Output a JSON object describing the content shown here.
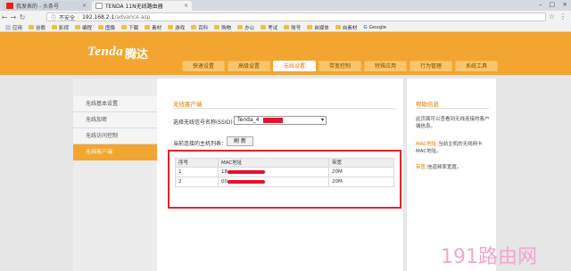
{
  "browser": {
    "tabs": [
      {
        "title": "我发表的 - 头条号"
      },
      {
        "title": "TENDA 11N无线路由器"
      }
    ],
    "address": {
      "security": "不安全",
      "host": "192.168.2.1",
      "path": "/advance.asp"
    },
    "bookmarks": [
      "应用",
      "谷歌",
      "影视",
      "编程",
      "图像",
      "下载",
      "素材",
      "游戏",
      "百科",
      "购物",
      "办公",
      "考试",
      "账号",
      "自媒体",
      "自素材",
      "Google"
    ]
  },
  "router": {
    "logo": "Tenda",
    "logo_cn": "腾达",
    "nav_tabs": [
      {
        "label": "快速设置"
      },
      {
        "label": "高级设置"
      },
      {
        "label": "无线设置"
      },
      {
        "label": "带宽控制"
      },
      {
        "label": "特殊应用"
      },
      {
        "label": "行为管理"
      },
      {
        "label": "系统工具"
      }
    ],
    "active_tab": 2,
    "sidebar": [
      {
        "label": "无线基本设置"
      },
      {
        "label": "无线加密"
      },
      {
        "label": "无线访问控制"
      },
      {
        "label": "无线客户端"
      }
    ],
    "active_sidebar": 3
  },
  "content": {
    "title": "无线客户端",
    "ssid_label": "选择无线信号名称(SSID)：",
    "ssid_value": "Tenda_4",
    "list_label": "当前连接的主机列表：",
    "refresh_button": "刷 新",
    "table": {
      "headers": [
        "序号",
        "MAC地址",
        "带宽"
      ],
      "rows": [
        {
          "index": "1",
          "mac": "18",
          "bandwidth": "20M"
        },
        {
          "index": "2",
          "mac": "00",
          "bandwidth": "20M"
        }
      ]
    }
  },
  "help": {
    "title": "帮助信息",
    "intro": "此页面可以查看到无线连接的客户端信息。",
    "mac_key": "MAC地址:",
    "mac_desc": "当前主机的无线网卡MAC地址。",
    "bw_key": "带宽:",
    "bw_desc": "信道频率宽度。"
  },
  "watermark": "191路由网",
  "colors": {
    "brand_orange": "#f3a532",
    "highlight_red": "#e0262a"
  }
}
